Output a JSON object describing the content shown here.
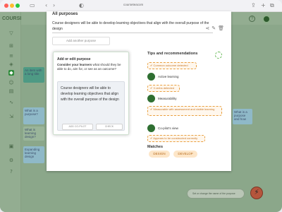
{
  "browser": {
    "url": "courseteacom"
  },
  "app": {
    "logo": "COURSETEA",
    "bg_cards": [
      {
        "text": "An item with a long title"
      },
      {
        "text": "What is a purpose?"
      },
      {
        "text": "What is learning design?"
      },
      {
        "text": "Expanding learning design"
      }
    ],
    "right_card_text": "What is a purpose and how",
    "search_prompt": "Set or change the name of the purpose"
  },
  "modal": {
    "title": "All purposes",
    "purpose_text": "Course designers will be able to develop learning objectives that align with the overall purpose of the design",
    "add_another_label": "Add another purpose"
  },
  "dialog": {
    "title": "Add or edit purpose",
    "prompt_bold": "Consider your learners",
    "prompt_rest": " what should they be able to do, aim for, or see as an outcome?",
    "textarea_value": "Course designers will be able to develop learning objectives that align with the overall purpose of the design",
    "copilot_label": "ADD CO-PILOT",
    "check_label": "CHECK"
  },
  "tips": {
    "title": "Tips and recommendations",
    "items": [
      {
        "kind": "warning",
        "text": "Common outcome detected"
      },
      {
        "kind": "ok",
        "text": "Active learning"
      },
      {
        "kind": "warning",
        "text": "3 verbs detected"
      },
      {
        "kind": "ok",
        "text": "Measurability"
      },
      {
        "kind": "warning",
        "text": "Measurable with assessment and visible learning"
      },
      {
        "kind": "ok",
        "text": "Co-pilot's view"
      },
      {
        "kind": "warning",
        "text": "Appears to be constructed correctly"
      }
    ],
    "matches_title": "Matches",
    "matches": [
      "DESIGN",
      "DEVELOP"
    ]
  },
  "colors": {
    "accent_green": "#2f6f32",
    "warning_orange": "#e9a040",
    "chip_bg": "#fde6c8"
  }
}
